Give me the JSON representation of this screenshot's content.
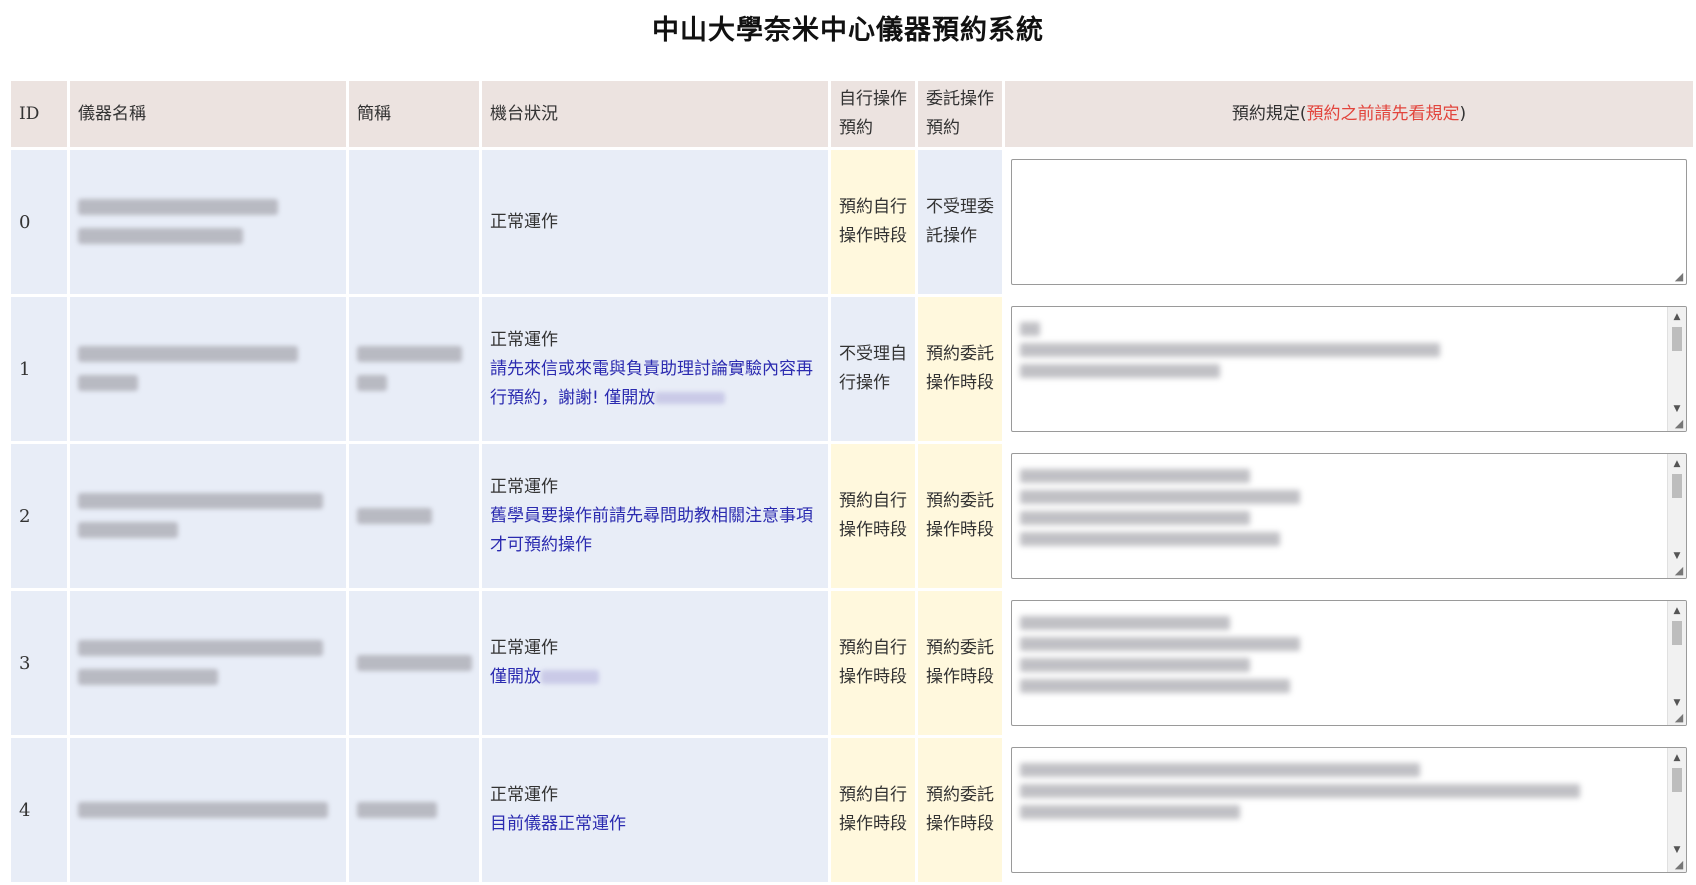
{
  "page": {
    "title": "中山大學奈米中心儀器預約系統"
  },
  "table": {
    "headers": {
      "id": "ID",
      "name": "儀器名稱",
      "abbr": "簡稱",
      "status": "機台狀況",
      "self_op": "自行操作預約",
      "delegate": "委託操作預約",
      "rules": "預約規定(",
      "rules_warning": "預約之前請先看規定",
      "rules_close": ")"
    },
    "rows": [
      {
        "id": "0",
        "status": "正常運作",
        "note": "",
        "self": "預約自行操作時段",
        "delegate": "不受理委託操作",
        "self_highlight": true,
        "delegate_highlight": false
      },
      {
        "id": "1",
        "status": "正常運作",
        "note": "請先來信或來電與負責助理討論實驗內容再行預約，謝謝! 僅開放",
        "self": "不受理自行操作",
        "delegate": "預約委託操作時段",
        "self_highlight": false,
        "delegate_highlight": true
      },
      {
        "id": "2",
        "status": "正常運作",
        "note": "舊學員要操作前請先尋問助教相關注意事項才可預約操作",
        "self": "預約自行操作時段",
        "delegate": "預約委託操作時段",
        "self_highlight": true,
        "delegate_highlight": true
      },
      {
        "id": "3",
        "status": "正常運作",
        "note": "僅開放",
        "self": "預約自行操作時段",
        "delegate": "預約委託操作時段",
        "self_highlight": true,
        "delegate_highlight": true
      },
      {
        "id": "4",
        "status": "正常運作",
        "note": "目前儀器正常運作",
        "self": "預約自行操作時段",
        "delegate": "預約委託操作時段",
        "self_highlight": true,
        "delegate_highlight": true
      }
    ]
  },
  "colors": {
    "header_bg": "#ece3e0",
    "cell_bg": "#e8edf7",
    "highlight_bg": "#fff8dd",
    "note_text": "#2b2bb0",
    "warning_text": "#e2453d"
  },
  "icons": {
    "scroll_up": "▲",
    "scroll_down": "▼",
    "resize_grip": "resize-grip-icon"
  }
}
